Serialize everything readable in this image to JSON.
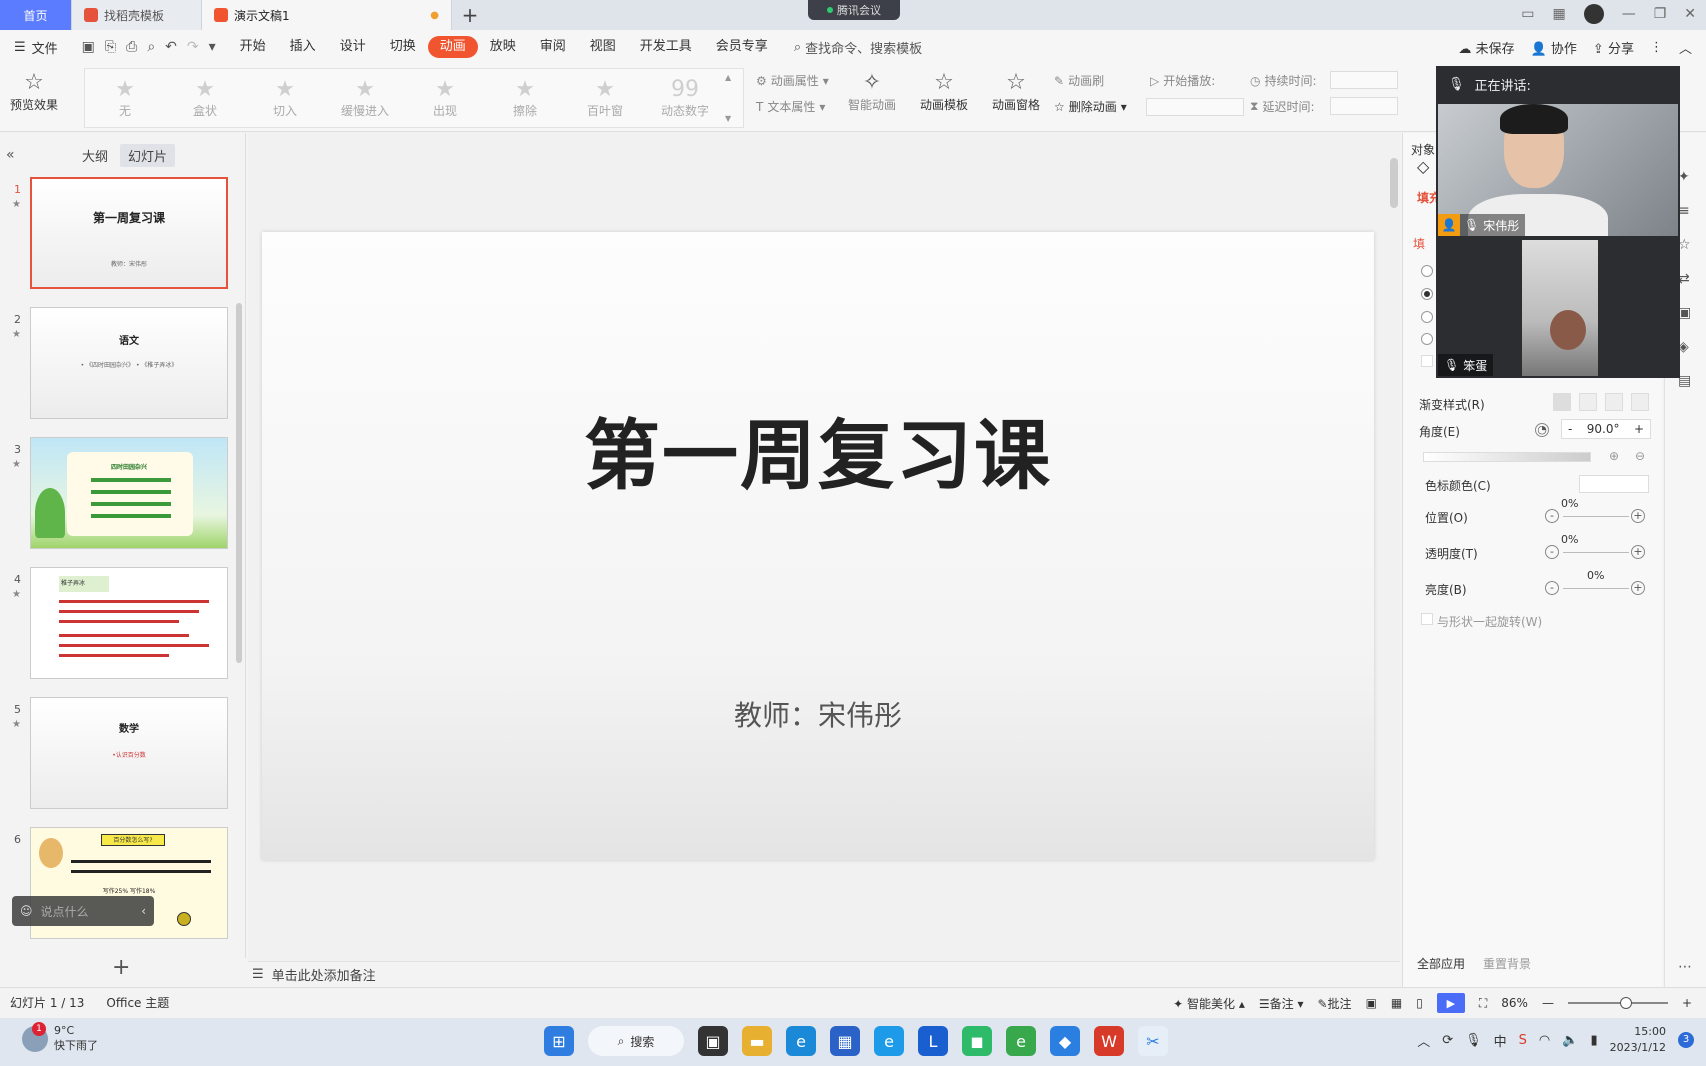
{
  "tabs": {
    "home": "首页",
    "store": "找稻壳模板",
    "doc": "演示文稿1",
    "new_tab": "+"
  },
  "meeting": {
    "label": "腾讯会议"
  },
  "menu": {
    "file": "文件",
    "items": [
      "开始",
      "插入",
      "设计",
      "切换",
      "动画",
      "放映",
      "审阅",
      "视图",
      "开发工具",
      "会员专享"
    ],
    "active": "动画",
    "search": "查找命令、搜索模板",
    "unsaved": "未保存",
    "collab": "协作",
    "share": "分享"
  },
  "ribbon": {
    "preview": "预览效果",
    "gallery": [
      "无",
      "盒状",
      "切入",
      "缓慢进入",
      "出现",
      "擦除",
      "百叶窗",
      "动态数字"
    ],
    "anim_props": "动画属性",
    "text_props": "文本属性",
    "smart_anim": "智能动画",
    "anim_template": "动画模板",
    "anim_pane": "动画窗格",
    "anim_brush": "动画刷",
    "delete_anim": "删除动画",
    "start_play": "开始播放:",
    "duration": "持续时间:",
    "delay": "延迟时间:"
  },
  "left_panel": {
    "tab_outline": "大纲",
    "tab_slides": "幻灯片",
    "slides": [
      {
        "num": "1",
        "title": "第一周复习课",
        "sub": "教师：宋伟彤"
      },
      {
        "num": "2",
        "title": "语文",
        "sub": "• 《四时田园杂兴》  • 《稚子弄冰》"
      },
      {
        "num": "3",
        "title": "四时田园杂兴",
        "sub": ""
      },
      {
        "num": "4",
        "title": "稚子弄冰",
        "sub": ""
      },
      {
        "num": "5",
        "title": "数学",
        "sub": "•认识百分数"
      },
      {
        "num": "6",
        "title": "百分数怎么写?",
        "sub": "写作25%  写作18%"
      }
    ],
    "chat_placeholder": "说点什么"
  },
  "slide": {
    "title": "第一周复习课",
    "subtitle": "教师：宋伟彤"
  },
  "notes_placeholder": "单击此处添加备注",
  "video": {
    "speaking": "正在讲话:",
    "person1": "宋伟彤",
    "person2": "笨蛋"
  },
  "right_panel": {
    "object_label": "对象",
    "fill_tab": "填充",
    "fill_section": "填",
    "gradient_style": "渐变样式(R)",
    "angle": "角度(E)",
    "angle_value": "90.0°",
    "stop_color": "色标颜色(C)",
    "position": "位置(O)",
    "position_value": "0%",
    "transparency": "透明度(T)",
    "transparency_value": "0%",
    "brightness": "亮度(B)",
    "brightness_value": "0%",
    "rotate_with_shape": "与形状一起旋转(W)",
    "apply_all": "全部应用",
    "reset_bg": "重置背景"
  },
  "statusbar": {
    "slide_info": "幻灯片 1 / 13",
    "theme": "Office 主题",
    "beautify": "智能美化",
    "notes": "备注",
    "comments": "批注",
    "zoom": "86%"
  },
  "taskbar": {
    "temp": "9°C",
    "weather": "快下雨了",
    "weather_badge": "1",
    "search": "搜索",
    "time": "15:00",
    "date": "2023/1/12",
    "notif_count": "3"
  }
}
